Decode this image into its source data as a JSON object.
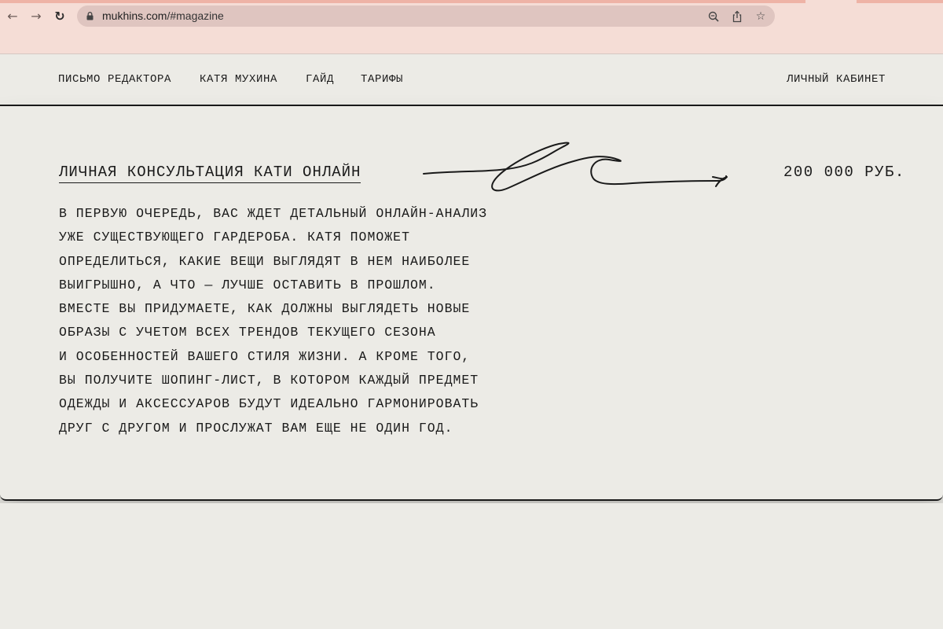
{
  "browser": {
    "url_host": "mukhins.com",
    "url_path": "/#magazine",
    "icons": {
      "back": "arrow-left-icon",
      "forward": "arrow-right-icon",
      "reload": "reload-icon",
      "lock": "lock-icon",
      "zoom": "zoom-icon",
      "share": "share-icon",
      "bookmark": "star-icon"
    }
  },
  "menu": {
    "items": [
      {
        "label": "ПИСЬМО РЕДАКТОРА"
      },
      {
        "label": "КАТЯ МУХИНА"
      },
      {
        "label": "ГАЙД"
      },
      {
        "label": "ТАРИФЫ"
      }
    ],
    "account": "ЛИЧНЫЙ КАБИНЕТ"
  },
  "service": {
    "title": "ЛИЧНАЯ КОНСУЛЬТАЦИЯ КАТИ ОНЛАЙН",
    "price": "200 000 РУБ.",
    "description_lines": [
      "В ПЕРВУЮ ОЧЕРЕДЬ, ВАС ЖДЕТ ДЕТАЛЬНЫЙ ОНЛАЙН-АНАЛИЗ",
      "УЖЕ СУЩЕСТВУЮЩЕГО ГАРДЕРОБА. КАТЯ ПОМОЖЕТ",
      "ОПРЕДЕЛИТЬСЯ, КАКИЕ ВЕЩИ ВЫГЛЯДЯТ В НЕМ НАИБОЛЕЕ",
      "ВЫИГРЫШНО, А ЧТО — ЛУЧШЕ ОСТАВИТЬ В ПРОШЛОМ.",
      "ВМЕСТЕ ВЫ ПРИДУМАЕТЕ, КАК ДОЛЖНЫ ВЫГЛЯДЕТЬ НОВЫЕ",
      "ОБРАЗЫ С УЧЕТОМ ВСЕХ ТРЕНДОВ ТЕКУЩЕГО СЕЗОНА",
      "И ОСОБЕННОСТЕЙ ВАШЕГО СТИЛЯ ЖИЗНИ. А КРОМЕ ТОГО,",
      "ВЫ ПОЛУЧИТЕ ШОПИНГ-ЛИСТ, В КОТОРОМ КАЖДЫЙ ПРЕДМЕТ",
      "ОДЕЖДЫ И АКСЕССУАРОВ БУДУТ ИДЕАЛЬНО ГАРМОНИРОВАТЬ",
      "ДРУГ С ДРУГОМ И ПРОСЛУЖАТ ВАМ ЕЩЕ НЕ ОДИН ГОД."
    ]
  },
  "colors": {
    "page_background": "#ecebe6",
    "browser_chrome": "#f5ddd6",
    "omnibox": "#dfc5c0",
    "text": "#1a1a1a"
  }
}
